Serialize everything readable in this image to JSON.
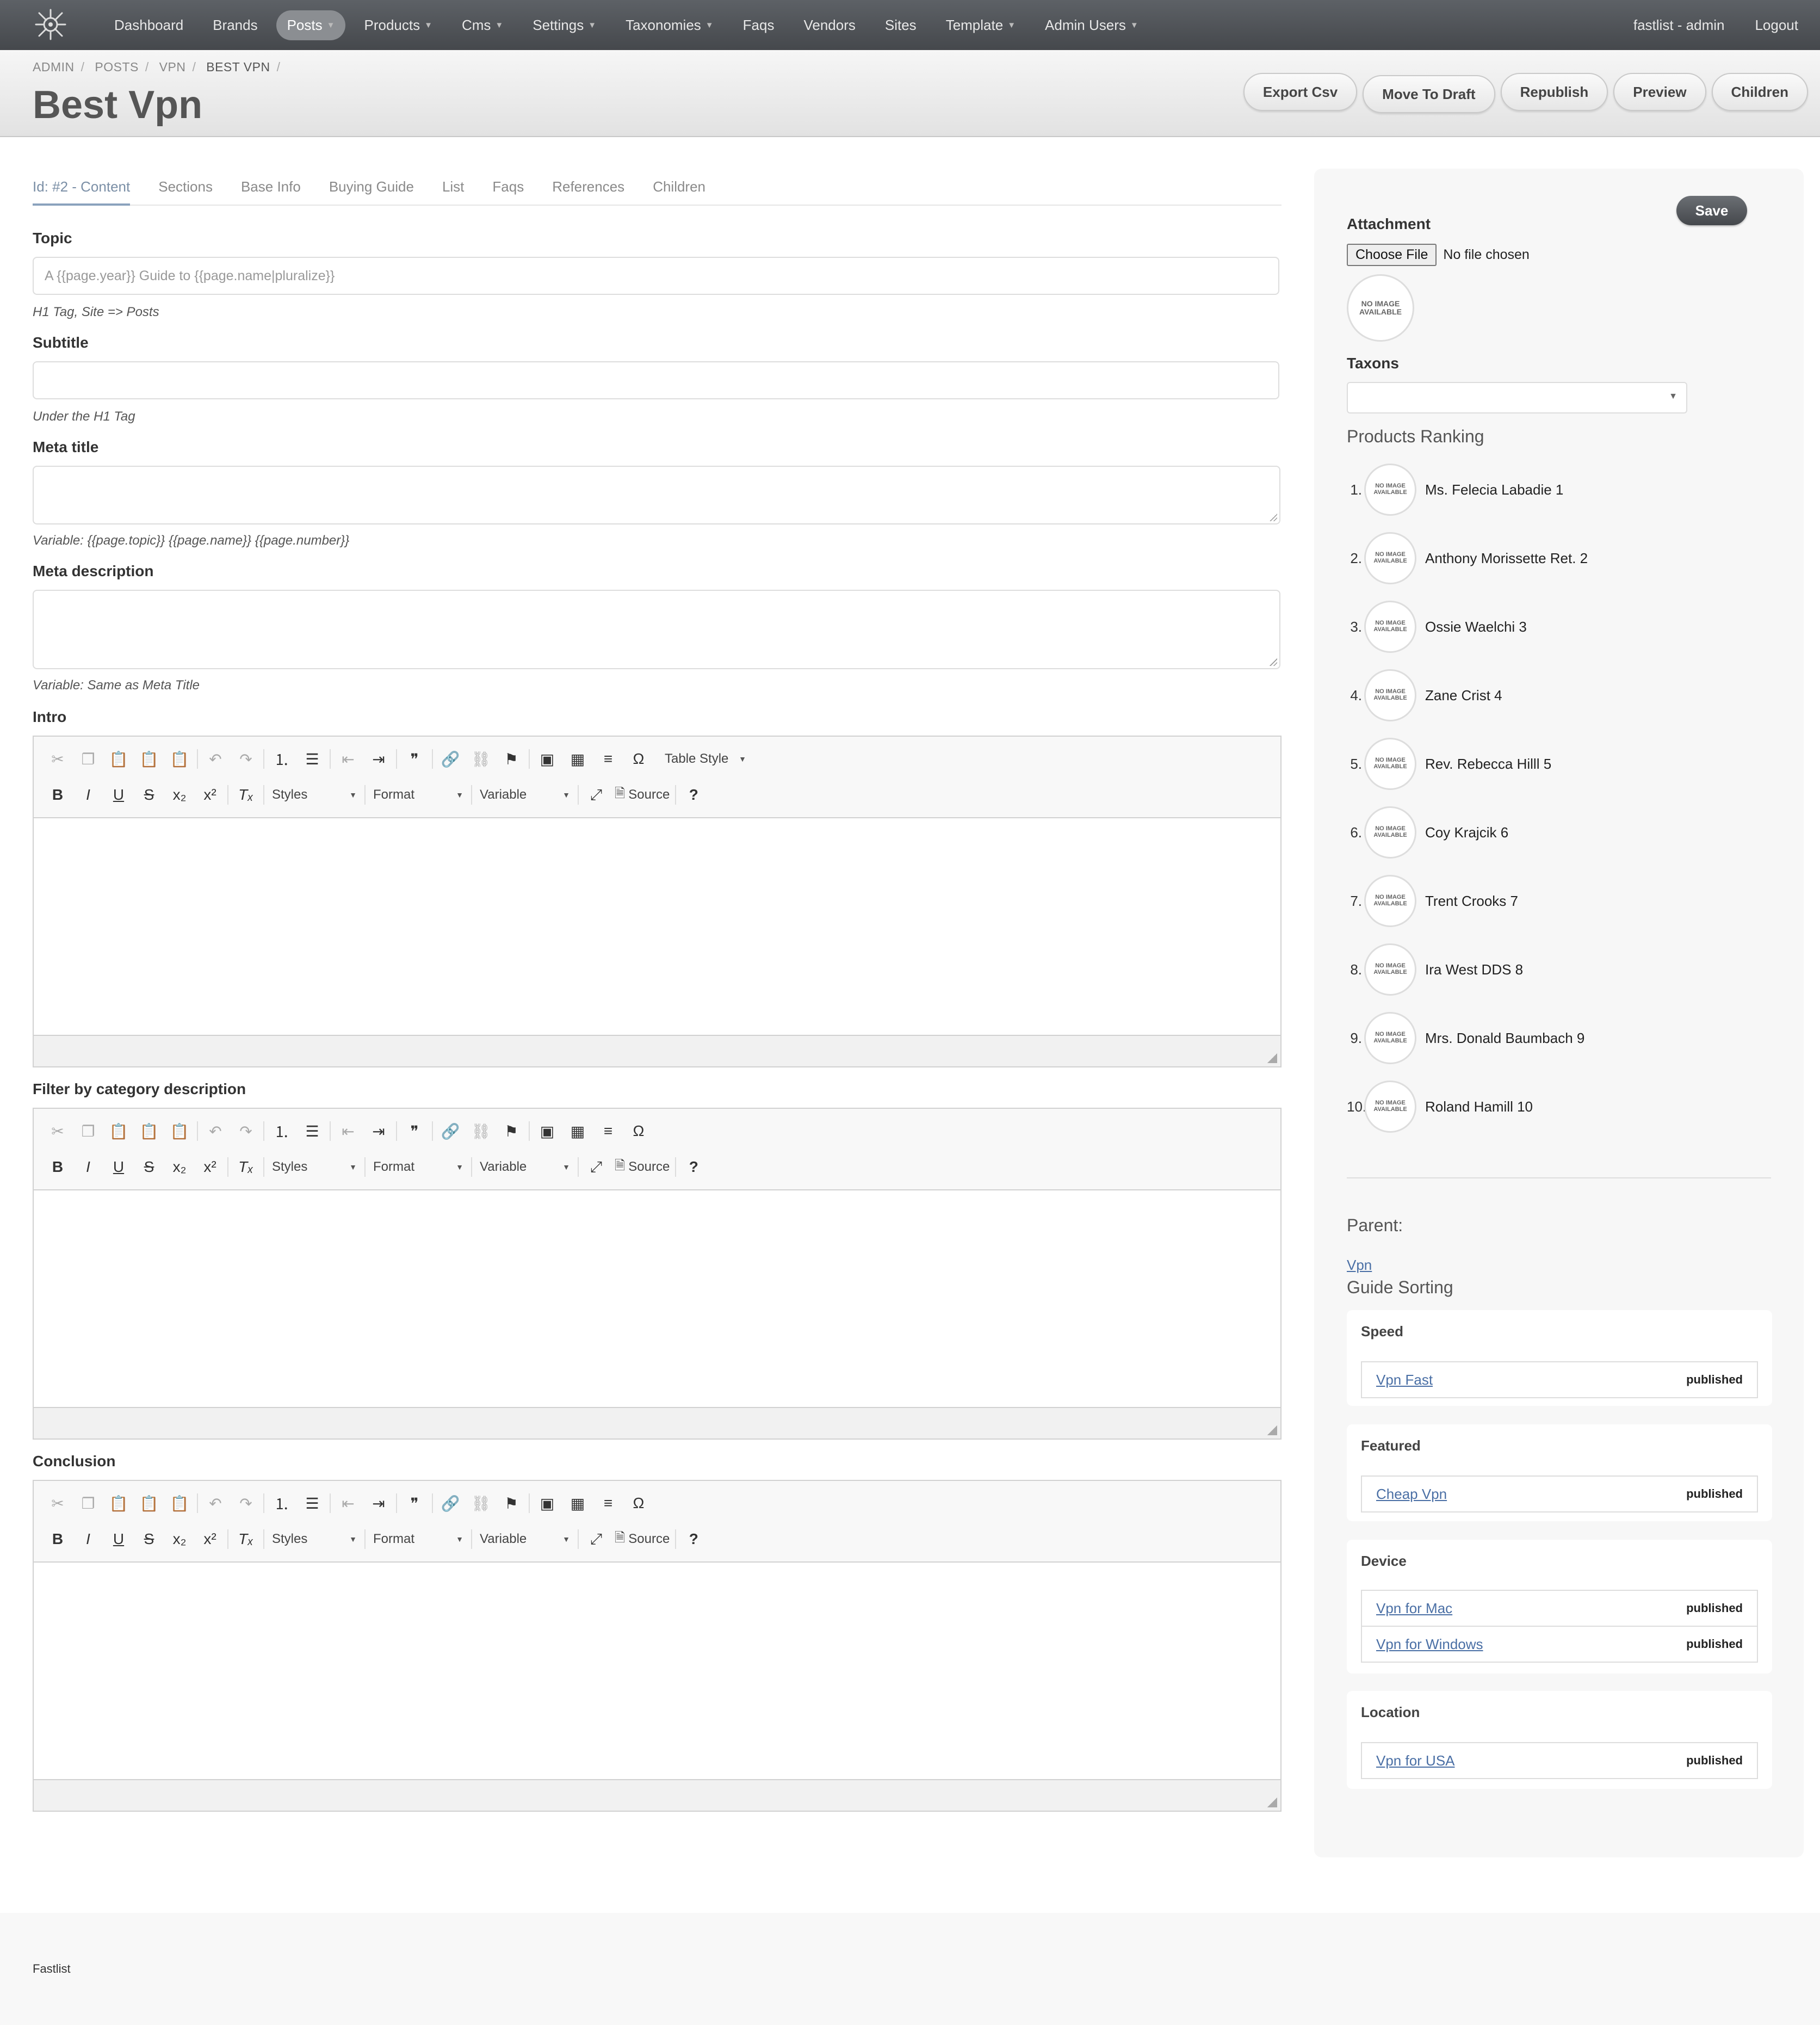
{
  "nav": {
    "items": [
      {
        "label": "Dashboard",
        "caret": false,
        "active": false
      },
      {
        "label": "Brands",
        "caret": false,
        "active": false
      },
      {
        "label": "Posts",
        "caret": true,
        "active": true
      },
      {
        "label": "Products",
        "caret": true,
        "active": false
      },
      {
        "label": "Cms",
        "caret": true,
        "active": false
      },
      {
        "label": "Settings",
        "caret": true,
        "active": false
      },
      {
        "label": "Taxonomies",
        "caret": true,
        "active": false
      },
      {
        "label": "Faqs",
        "caret": false,
        "active": false
      },
      {
        "label": "Vendors",
        "caret": false,
        "active": false
      },
      {
        "label": "Sites",
        "caret": false,
        "active": false
      },
      {
        "label": "Template",
        "caret": true,
        "active": false
      },
      {
        "label": "Admin Users",
        "caret": true,
        "active": false
      }
    ],
    "user": "fastlist - admin",
    "logout": "Logout"
  },
  "breadcrumb": [
    "ADMIN",
    "POSTS",
    "VPN",
    "BEST VPN"
  ],
  "page_title": "Best Vpn",
  "header_buttons": [
    "Export Csv",
    "Move To Draft",
    "Republish",
    "Preview",
    "Children"
  ],
  "tabs": [
    "Id: #2 - Content",
    "Sections",
    "Base Info",
    "Buying Guide",
    "List",
    "Faqs",
    "References",
    "Children"
  ],
  "form": {
    "topic_label": "Topic",
    "topic_placeholder": "A {{page.year}} Guide to {{page.name|pluralize}}",
    "topic_help": "H1 Tag, Site => Posts",
    "subtitle_label": "Subtitle",
    "subtitle_help": "Under the H1 Tag",
    "meta_title_label": "Meta title",
    "meta_title_help": "Variable: {{page.topic}} {{page.name}} {{page.number}}",
    "meta_desc_label": "Meta description",
    "meta_desc_help": "Variable: Same as Meta Title",
    "intro_label": "Intro",
    "filter_label": "Filter by category description",
    "conclusion_label": "Conclusion"
  },
  "editor": {
    "table_style": "Table Style",
    "styles": "Styles",
    "format": "Format",
    "variable": "Variable",
    "source": "Source"
  },
  "sidebar": {
    "save": "Save",
    "attachment_label": "Attachment",
    "choose_file": "Choose File",
    "file_status": "No file chosen",
    "no_image": "NO IMAGE AVAILABLE",
    "taxons_label": "Taxons",
    "ranking_heading": "Products Ranking",
    "ranking": [
      {
        "num": "1.",
        "name": "Ms. Felecia Labadie 1"
      },
      {
        "num": "2.",
        "name": "Anthony Morissette Ret. 2"
      },
      {
        "num": "3.",
        "name": "Ossie Waelchi 3"
      },
      {
        "num": "4.",
        "name": "Zane Crist 4"
      },
      {
        "num": "5.",
        "name": "Rev. Rebecca Hilll 5"
      },
      {
        "num": "6.",
        "name": "Coy Krajcik 6"
      },
      {
        "num": "7.",
        "name": "Trent Crooks 7"
      },
      {
        "num": "8.",
        "name": "Ira West DDS 8"
      },
      {
        "num": "9.",
        "name": "Mrs. Donald Baumbach 9"
      },
      {
        "num": "10.",
        "name": "Roland Hamill 10"
      }
    ],
    "parent_heading": "Parent:",
    "parent_link": "Vpn",
    "guide_heading": "Guide Sorting",
    "groups": [
      {
        "title": "Speed",
        "rows": [
          {
            "link": "Vpn Fast",
            "status": "published"
          }
        ]
      },
      {
        "title": "Featured",
        "rows": [
          {
            "link": "Cheap Vpn",
            "status": "published"
          }
        ]
      },
      {
        "title": "Device",
        "rows": [
          {
            "link": "Vpn for Mac",
            "status": "published"
          },
          {
            "link": "Vpn for Windows",
            "status": "published"
          }
        ]
      },
      {
        "title": "Location",
        "rows": [
          {
            "link": "Vpn for USA",
            "status": "published"
          }
        ]
      }
    ]
  },
  "footer": "Fastlist"
}
